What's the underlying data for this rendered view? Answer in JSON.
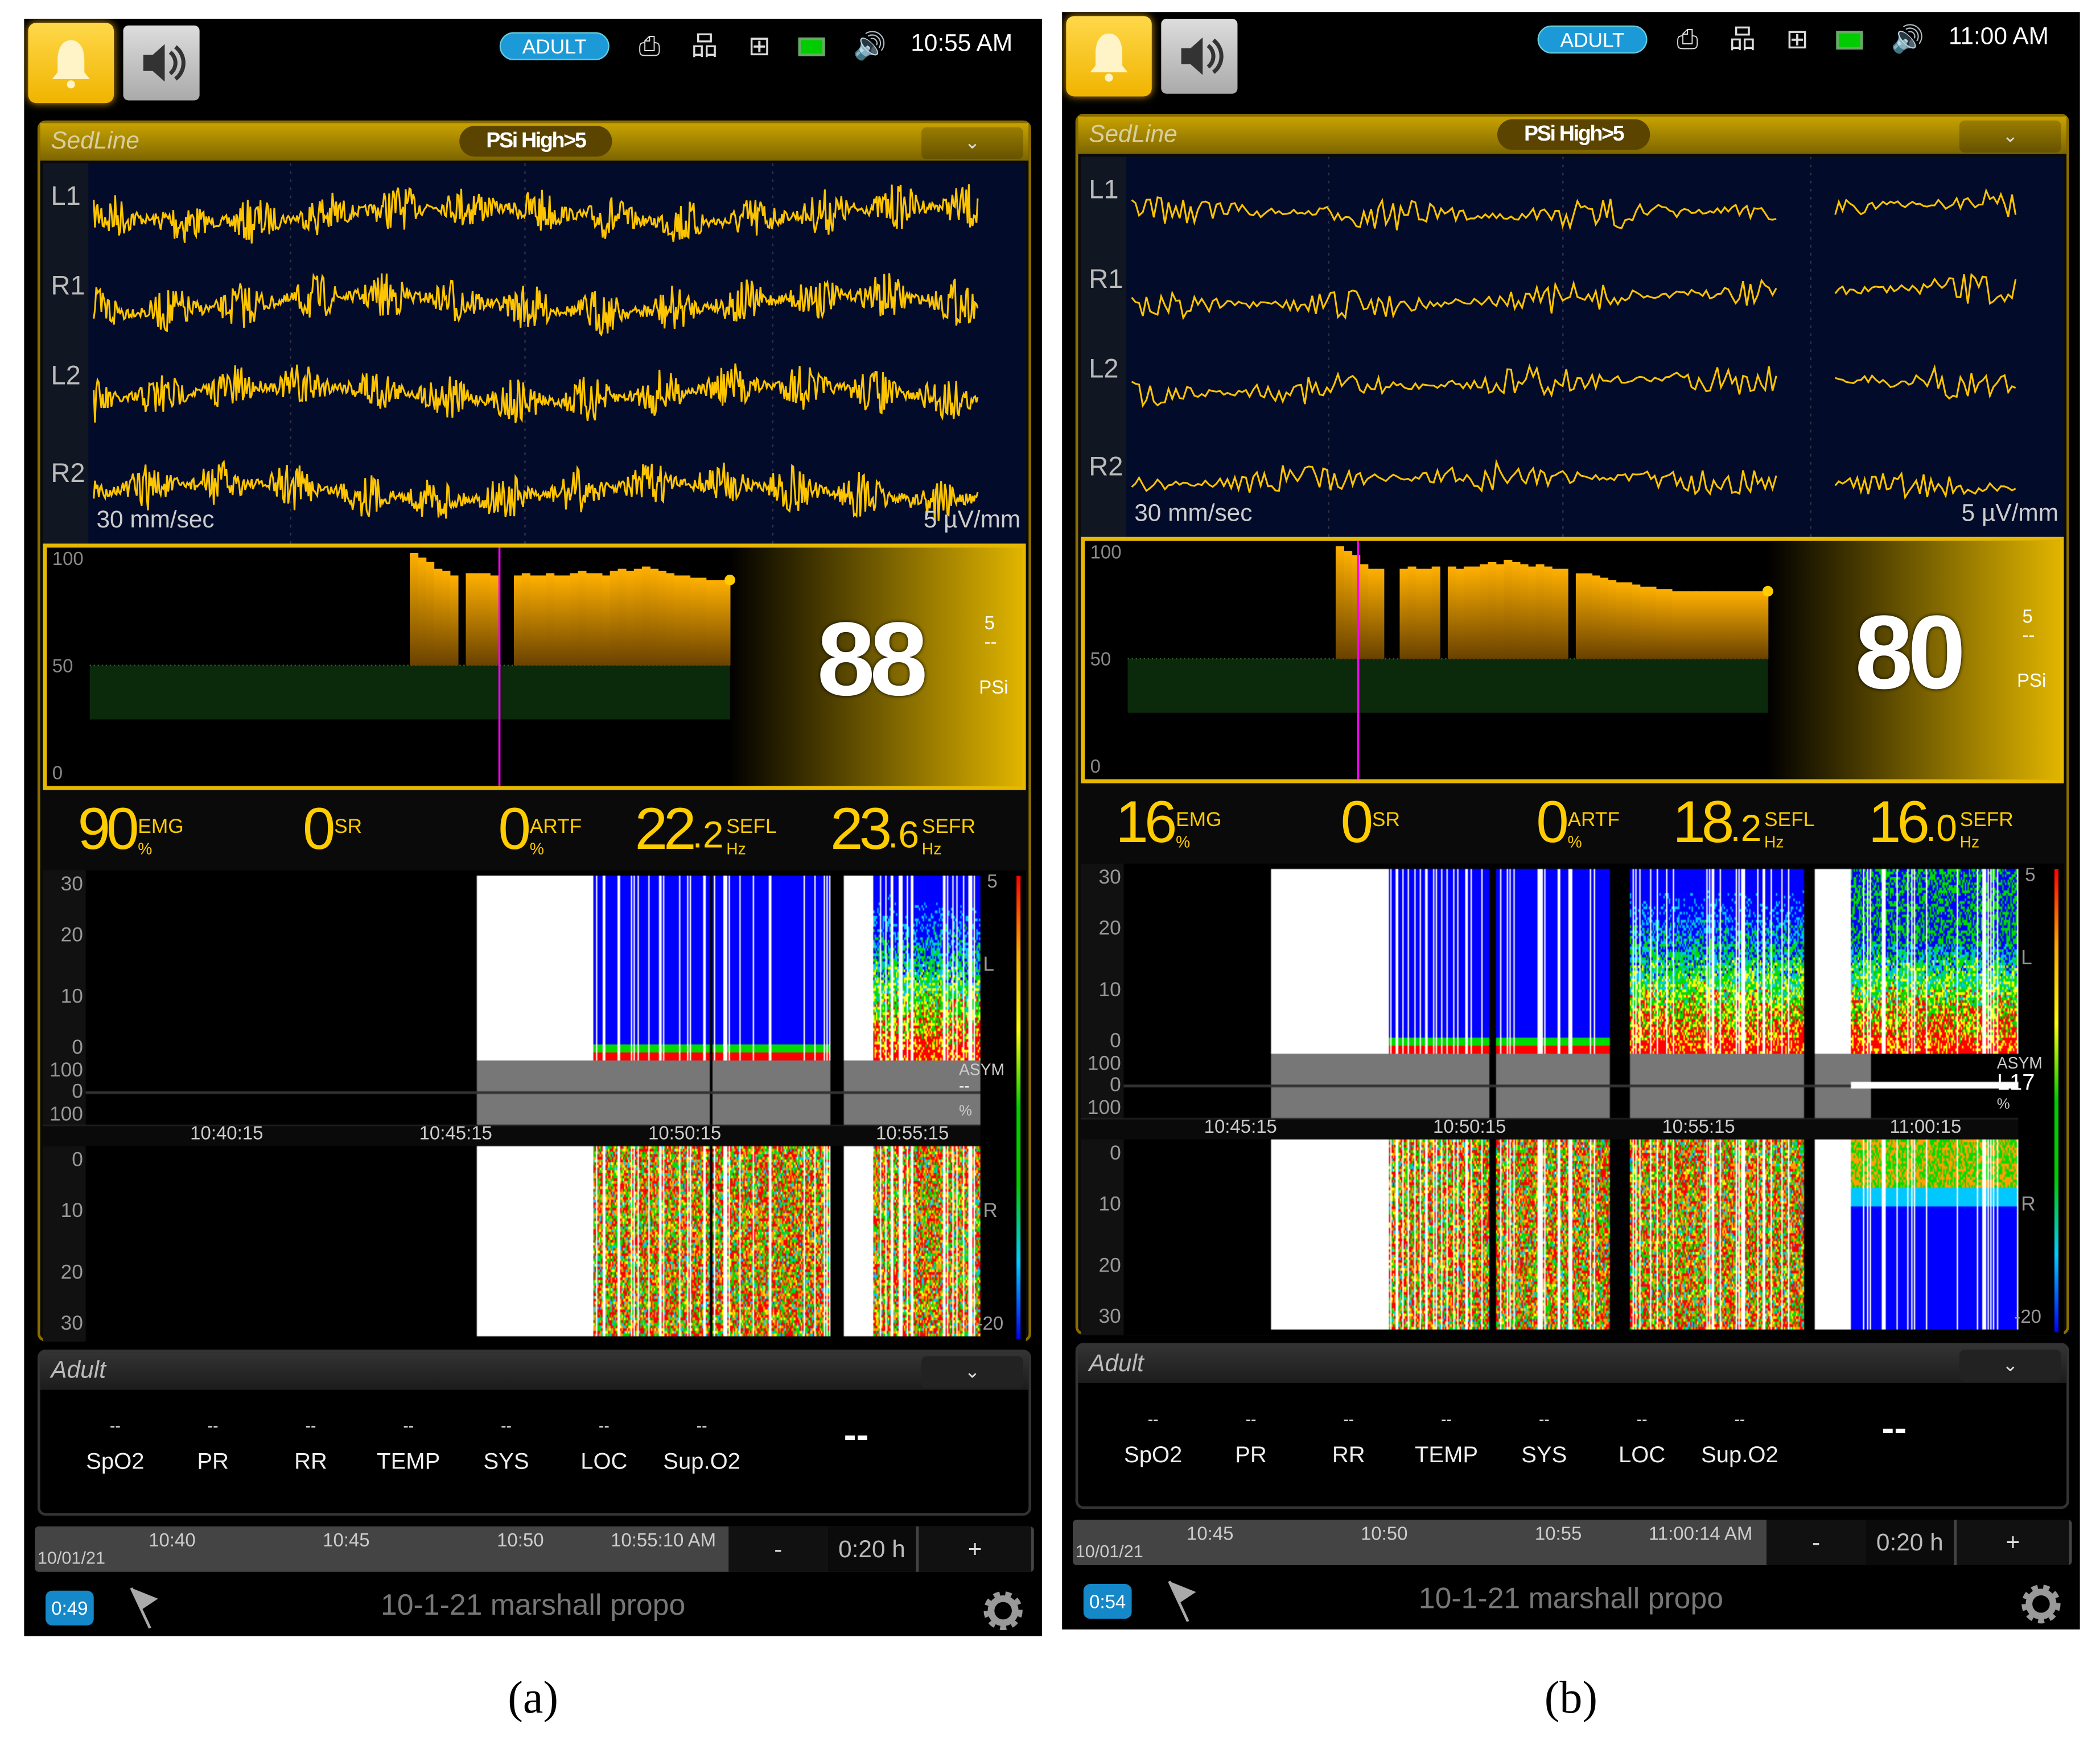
{
  "panels": [
    {
      "top_bar": {
        "mode": "ADULT",
        "time": "10:55 AM"
      },
      "sedline": {
        "title": "SedLine",
        "alarm": "PSi High>5",
        "speed": "30 mm/sec",
        "gain": "5 µV/mm",
        "channels": [
          "L1",
          "R1",
          "L2",
          "R2"
        ],
        "psi": {
          "value": "88",
          "limit": "5",
          "dashes": "--",
          "label": "PSi",
          "scale": [
            "100",
            "50",
            "0"
          ],
          "trend": [
            null,
            null,
            null,
            null,
            null,
            null,
            null,
            null,
            null,
            null,
            null,
            null,
            null,
            null,
            null,
            null,
            null,
            null,
            null,
            null,
            null,
            null,
            null,
            null,
            null,
            null,
            null,
            null,
            null,
            null,
            null,
            null,
            null,
            null,
            null,
            null,
            null,
            null,
            null,
            null,
            100,
            98,
            96,
            93,
            92,
            90,
            null,
            91,
            91,
            91,
            90,
            null,
            null,
            90,
            91,
            90,
            90,
            91,
            90,
            90,
            91,
            92,
            91,
            91,
            90,
            92,
            93,
            92,
            93,
            94,
            93,
            92,
            91,
            90,
            90,
            89,
            89,
            88,
            88,
            88
          ]
        },
        "params": [
          {
            "int": "90",
            "dec": "",
            "label": "EMG",
            "unit": "%"
          },
          {
            "int": "0",
            "dec": "",
            "label": "SR",
            "unit": ""
          },
          {
            "int": "0",
            "dec": "",
            "label": "ARTF",
            "unit": "%"
          },
          {
            "int": "22",
            "dec": ".2",
            "label": "SEFL",
            "unit": "Hz"
          },
          {
            "int": "23",
            "dec": ".6",
            "label": "SEFR",
            "unit": "Hz"
          }
        ],
        "dsa": {
          "left_ticks": [
            "30",
            "20",
            "10",
            "0"
          ],
          "asym_ticks": [
            "100",
            "0",
            "100"
          ],
          "right_ticks": [
            "0",
            "10",
            "20",
            "30"
          ],
          "times": [
            "10:40:15",
            "10:45:15",
            "10:50:15",
            "10:55:15"
          ],
          "colorbar": [
            "5",
            "-20"
          ],
          "left_label": "L",
          "right_label": "R",
          "asym_label": "ASYM",
          "asym_value": "--",
          "asym_unit": "%"
        }
      },
      "adult": {
        "title": "Adult",
        "params": [
          {
            "label": "SpO2",
            "value": "--"
          },
          {
            "label": "PR",
            "value": "--"
          },
          {
            "label": "RR",
            "value": "--"
          },
          {
            "label": "TEMP",
            "value": "--"
          },
          {
            "label": "SYS",
            "value": "--"
          },
          {
            "label": "LOC",
            "value": "--"
          },
          {
            "label": "Sup.O2",
            "value": "--"
          }
        ],
        "extra": "--"
      },
      "timeline": {
        "date": "10/01/21",
        "ticks": [
          "10:40",
          "10:45",
          "10:50",
          "10:55:10 AM"
        ],
        "minus": "-",
        "span": "0:20 h",
        "plus": "+"
      },
      "bottom": {
        "timer": "0:49",
        "session": "10-1-21 marshall propo"
      },
      "caption": "(a)"
    },
    {
      "top_bar": {
        "mode": "ADULT",
        "time": "11:00 AM"
      },
      "sedline": {
        "title": "SedLine",
        "alarm": "PSi High>5",
        "speed": "30 mm/sec",
        "gain": "5 µV/mm",
        "channels": [
          "L1",
          "R1",
          "L2",
          "R2"
        ],
        "psi": {
          "value": "80",
          "limit": "5",
          "dashes": "--",
          "label": "PSi",
          "scale": [
            "100",
            "50",
            "0"
          ],
          "trend": [
            null,
            null,
            null,
            null,
            null,
            null,
            null,
            null,
            null,
            null,
            null,
            null,
            null,
            null,
            null,
            null,
            null,
            null,
            null,
            null,
            null,
            null,
            null,
            null,
            null,
            null,
            100,
            98,
            96,
            92,
            90,
            90,
            null,
            null,
            90,
            91,
            90,
            90,
            91,
            null,
            91,
            90,
            91,
            91,
            92,
            93,
            92,
            94,
            93,
            92,
            91,
            92,
            91,
            90,
            90,
            null,
            88,
            88,
            87,
            86,
            85,
            84,
            84,
            83,
            82,
            82,
            81,
            81,
            80,
            80,
            80,
            80,
            80,
            80,
            80,
            80,
            80,
            80,
            80,
            80
          ]
        },
        "params": [
          {
            "int": "16",
            "dec": "",
            "label": "EMG",
            "unit": "%"
          },
          {
            "int": "0",
            "dec": "",
            "label": "SR",
            "unit": ""
          },
          {
            "int": "0",
            "dec": "",
            "label": "ARTF",
            "unit": "%"
          },
          {
            "int": "18",
            "dec": ".2",
            "label": "SEFL",
            "unit": "Hz"
          },
          {
            "int": "16",
            "dec": ".0",
            "label": "SEFR",
            "unit": "Hz"
          }
        ],
        "dsa": {
          "left_ticks": [
            "30",
            "20",
            "10",
            "0"
          ],
          "asym_ticks": [
            "100",
            "0",
            "100"
          ],
          "right_ticks": [
            "0",
            "10",
            "20",
            "30"
          ],
          "times": [
            "10:45:15",
            "10:50:15",
            "10:55:15",
            "11:00:15"
          ],
          "colorbar": [
            "5",
            "-20"
          ],
          "left_label": "L",
          "right_label": "R",
          "asym_label": "ASYM",
          "asym_value": "L17",
          "asym_unit": "%"
        }
      },
      "adult": {
        "title": "Adult",
        "params": [
          {
            "label": "SpO2",
            "value": "--"
          },
          {
            "label": "PR",
            "value": "--"
          },
          {
            "label": "RR",
            "value": "--"
          },
          {
            "label": "TEMP",
            "value": "--"
          },
          {
            "label": "SYS",
            "value": "--"
          },
          {
            "label": "LOC",
            "value": "--"
          },
          {
            "label": "Sup.O2",
            "value": "--"
          }
        ],
        "extra": "--"
      },
      "timeline": {
        "date": "10/01/21",
        "ticks": [
          "10:45",
          "10:50",
          "10:55",
          "11:00:14 AM"
        ],
        "minus": "-",
        "span": "0:20 h",
        "plus": "+"
      },
      "bottom": {
        "timer": "0:54",
        "session": "10-1-21 marshall propo"
      },
      "caption": "(b)"
    }
  ],
  "colors": {
    "gold": "#f5c400",
    "eeg_bg": "#020c2a",
    "trace": "#ffc400",
    "pill": "#1c9ad8",
    "cursor": "#ff00ff"
  }
}
